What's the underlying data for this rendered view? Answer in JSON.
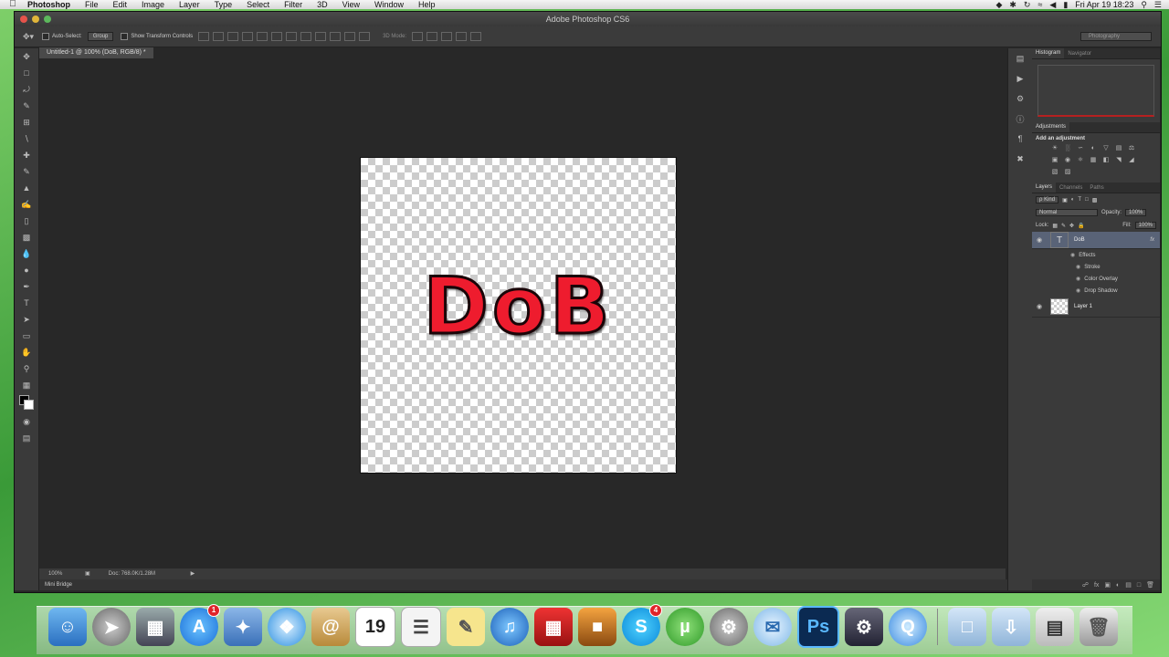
{
  "menubar": {
    "app": "Photoshop",
    "items": [
      "File",
      "Edit",
      "Image",
      "Layer",
      "Type",
      "Select",
      "Filter",
      "3D",
      "View",
      "Window",
      "Help"
    ],
    "clock": "Fri Apr 19  18:23"
  },
  "window": {
    "title": "Adobe Photoshop CS6",
    "doc_tab": "Untitled-1 @ 100% (DoB, RGB/8) *"
  },
  "options_bar": {
    "auto_select_label": "Auto-Select:",
    "auto_select_value": "Group",
    "show_transform_label": "Show Transform Controls",
    "mode_label": "3D Mode:",
    "workspace": "Photography"
  },
  "canvas": {
    "text": "DoB",
    "fill_color": "#ee1c2e",
    "stroke_color": "#1a0508"
  },
  "status": {
    "zoom": "100%",
    "doc_info": "Doc: 768.0K/1.28M",
    "mini_bridge": "Mini Bridge"
  },
  "panels": {
    "top_tabs": [
      "Histogram",
      "Navigator"
    ],
    "adjustments_tab": "Adjustments",
    "adjustments_heading": "Add an adjustment",
    "layer_tabs": [
      "Layers",
      "Channels",
      "Paths"
    ],
    "kind_label": "ρ Kind",
    "blend_mode": "Normal",
    "opacity_label": "Opacity:",
    "opacity_value": "100%",
    "lock_label": "Lock:",
    "fill_label": "Fill:",
    "fill_value": "100%",
    "layers": [
      {
        "name": "DoB",
        "thumb": "T",
        "fx": "fx"
      },
      {
        "name": "Layer 1"
      }
    ],
    "effects_label": "Effects",
    "effects": [
      "Stroke",
      "Color Overlay",
      "Drop Shadow"
    ]
  },
  "dock": {
    "appstore_badge": "1",
    "calendar_day": "19",
    "skype_badge": "4",
    "photoshop_label": "Ps"
  }
}
